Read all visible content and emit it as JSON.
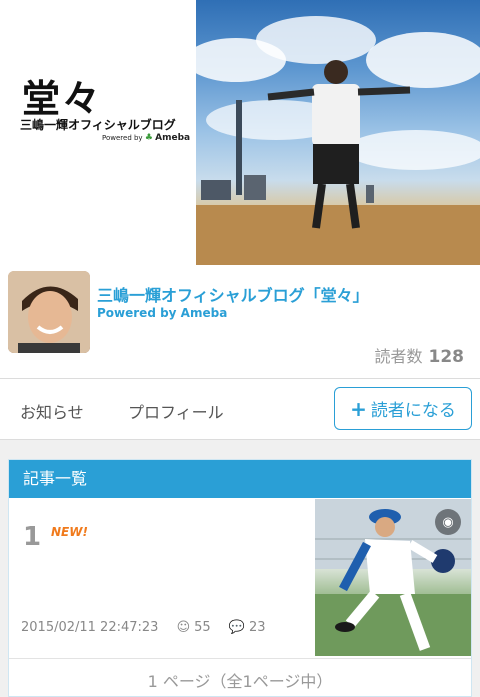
{
  "banner": {
    "logo_title": "堂々",
    "logo_subtitle": "三嶋一輝オフィシャルブログ",
    "powered_prefix": "Powered by",
    "powered_brand": "Ameba"
  },
  "blog": {
    "title": "三嶋一輝オフィシャルブログ「堂々」",
    "powered": "Powered by Ameba",
    "readers_label": "読者数",
    "readers_count": "128"
  },
  "nav": {
    "news": "お知らせ",
    "profile": "プロフィール",
    "follow_label": "読者になる"
  },
  "articles": {
    "header": "記事一覧",
    "entries": [
      {
        "number": "1",
        "badge": "NEW!",
        "timestamp": "2015/02/11 22:47:23",
        "likes": "55",
        "comments": "23"
      }
    ],
    "pager": "1 ページ（全1ページ中）"
  },
  "colors": {
    "accent": "#2a9fd6",
    "new_badge": "#f07a1c"
  }
}
